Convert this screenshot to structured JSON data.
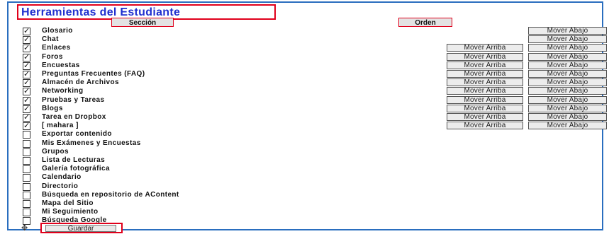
{
  "title": "Herramientas del Estudiante",
  "headers": {
    "section": "Sección",
    "order": "Orden"
  },
  "buttons": {
    "move_up": "Mover Arriba",
    "move_down": "Mover Abajo",
    "save": "Guardar"
  },
  "tools": [
    {
      "label": "Glosario",
      "checked": true,
      "up": false,
      "down": true
    },
    {
      "label": "Chat",
      "checked": true,
      "up": false,
      "down": true
    },
    {
      "label": "Enlaces",
      "checked": true,
      "up": true,
      "down": true
    },
    {
      "label": "Foros",
      "checked": true,
      "up": true,
      "down": true
    },
    {
      "label": "Encuestas",
      "checked": true,
      "up": true,
      "down": true
    },
    {
      "label": "Preguntas Frecuentes (FAQ)",
      "checked": true,
      "up": true,
      "down": true
    },
    {
      "label": "Almacén de Archivos",
      "checked": true,
      "up": true,
      "down": true
    },
    {
      "label": "Networking",
      "checked": true,
      "up": true,
      "down": true
    },
    {
      "label": "Pruebas y Tareas",
      "checked": true,
      "up": true,
      "down": true
    },
    {
      "label": "Blogs",
      "checked": true,
      "up": true,
      "down": true
    },
    {
      "label": "Tarea en Dropbox",
      "checked": true,
      "up": true,
      "down": true
    },
    {
      "label": "[ mahara ]",
      "checked": true,
      "up": true,
      "down": true
    },
    {
      "label": "Exportar contenido",
      "checked": false,
      "up": false,
      "down": false
    },
    {
      "label": "Mis Exámenes y Encuestas",
      "checked": false,
      "up": false,
      "down": false
    },
    {
      "label": "Grupos",
      "checked": false,
      "up": false,
      "down": false
    },
    {
      "label": "Lista de Lecturas",
      "checked": false,
      "up": false,
      "down": false
    },
    {
      "label": "Galería fotográfica",
      "checked": false,
      "up": false,
      "down": false
    },
    {
      "label": "Calendario",
      "checked": false,
      "up": false,
      "down": false
    },
    {
      "label": "Directorio",
      "checked": false,
      "up": false,
      "down": false
    },
    {
      "label": "Búsqueda en repositorio de AContent",
      "checked": false,
      "up": false,
      "down": false
    },
    {
      "label": "Mapa del Sitio",
      "checked": false,
      "up": false,
      "down": false
    },
    {
      "label": "Mi Seguimiento",
      "checked": false,
      "up": false,
      "down": false
    },
    {
      "label": "Búsqueda Google",
      "checked": false,
      "up": false,
      "down": false
    }
  ]
}
